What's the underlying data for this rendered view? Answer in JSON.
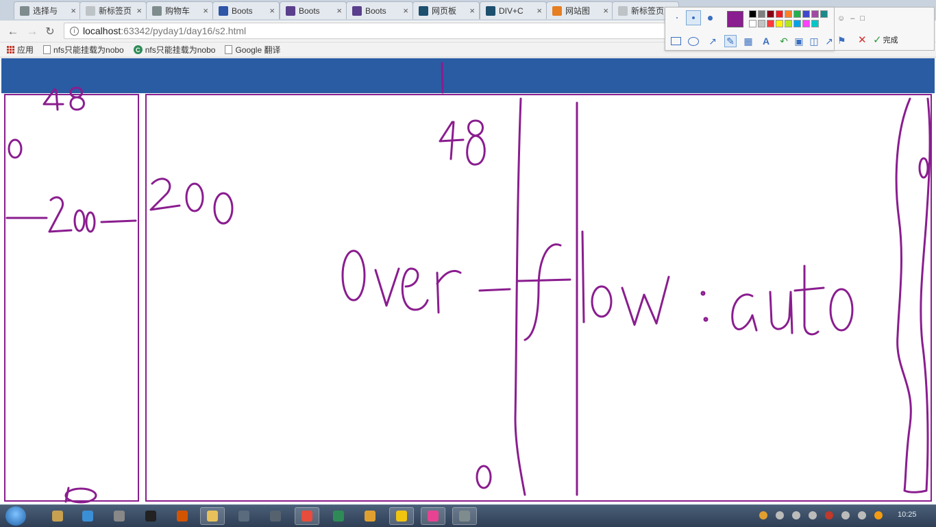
{
  "browser": {
    "tabs": [
      {
        "title": "选择与",
        "icon": "document-icon",
        "color": "#7f8c8d"
      },
      {
        "title": "新标签页",
        "icon": "blank-icon",
        "color": "#bdc3c7"
      },
      {
        "title": "购物车",
        "icon": "document-icon",
        "color": "#7f8c8d"
      },
      {
        "title": "Boots",
        "icon": "paw-icon",
        "color": "#2d55a8"
      },
      {
        "title": "Boots",
        "icon": "bootstrap-b-icon",
        "color": "#5a3f8c"
      },
      {
        "title": "Boots",
        "icon": "bootstrap-hex-icon",
        "color": "#5a3f8c"
      },
      {
        "title": "网页板",
        "icon": "ide-icon",
        "color": "#1d4f6e"
      },
      {
        "title": "DIV+C",
        "icon": "ide-icon",
        "color": "#1d4f6e"
      },
      {
        "title": "网站图",
        "icon": "orange-circle-icon",
        "color": "#e67e22"
      },
      {
        "title": "新标签页",
        "icon": "blank-icon",
        "color": "#bdc3c7"
      }
    ],
    "url_host": "localhost",
    "url_path": ":63342/pyday1/day16/s2.html",
    "bookmarks": [
      {
        "label": "应用",
        "icon": "apps-grid-icon"
      },
      {
        "label": "nfs只能挂载为nobo",
        "icon": "page-icon"
      },
      {
        "label": "nfs只能挂载为nobo",
        "icon": "green-c-icon"
      },
      {
        "label": "Google 翻译",
        "icon": "page-icon"
      }
    ]
  },
  "annotations": {
    "pen_color": "#8a1d8f",
    "texts": [
      "48",
      "0",
      "200",
      "48",
      "200",
      "over-flow:auto",
      "0",
      "0",
      "0"
    ]
  },
  "snip_toolbar": {
    "selected_color": "#8a1d8f",
    "palette": [
      "#000000",
      "#7f7f7f",
      "#880015",
      "#ed1c24",
      "#ff7f27",
      "#22b14c",
      "#3f48cc",
      "#a349a4",
      "#1b8a8a",
      "#ffffff",
      "#c3c3c3",
      "#ff3b3b",
      "#fff200",
      "#b5e61d",
      "#00a2e8",
      "#ff40ff",
      "#00c8c8"
    ],
    "done_label": "完成"
  },
  "page_colors": {
    "header": "#2a5ca3",
    "border": "#8a1d8f"
  },
  "taskbar": {
    "clock": "10:25"
  }
}
